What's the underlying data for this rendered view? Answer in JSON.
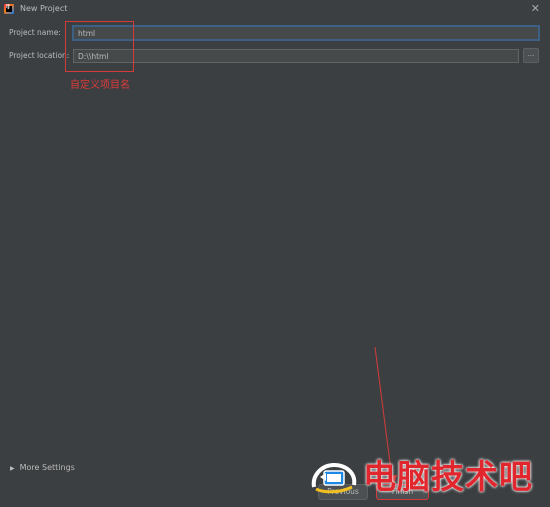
{
  "window": {
    "title": "New Project"
  },
  "form": {
    "project_name_label": "Project name:",
    "project_name_value": "html",
    "project_location_label": "Project location:",
    "project_location_value": "D:\\\\html",
    "browse_label": "..."
  },
  "annotation": {
    "text": "自定义项目名",
    "color": "#e03a3a"
  },
  "footer": {
    "more_settings_label": "More Settings",
    "previous_label": "Previous",
    "finish_label": "Finish"
  },
  "watermark": {
    "text": "电脑技术吧",
    "color": "#e2262d"
  },
  "theme": {
    "background": "#3c3f41",
    "field_background": "#45494a",
    "focus_border": "#3d6185"
  }
}
